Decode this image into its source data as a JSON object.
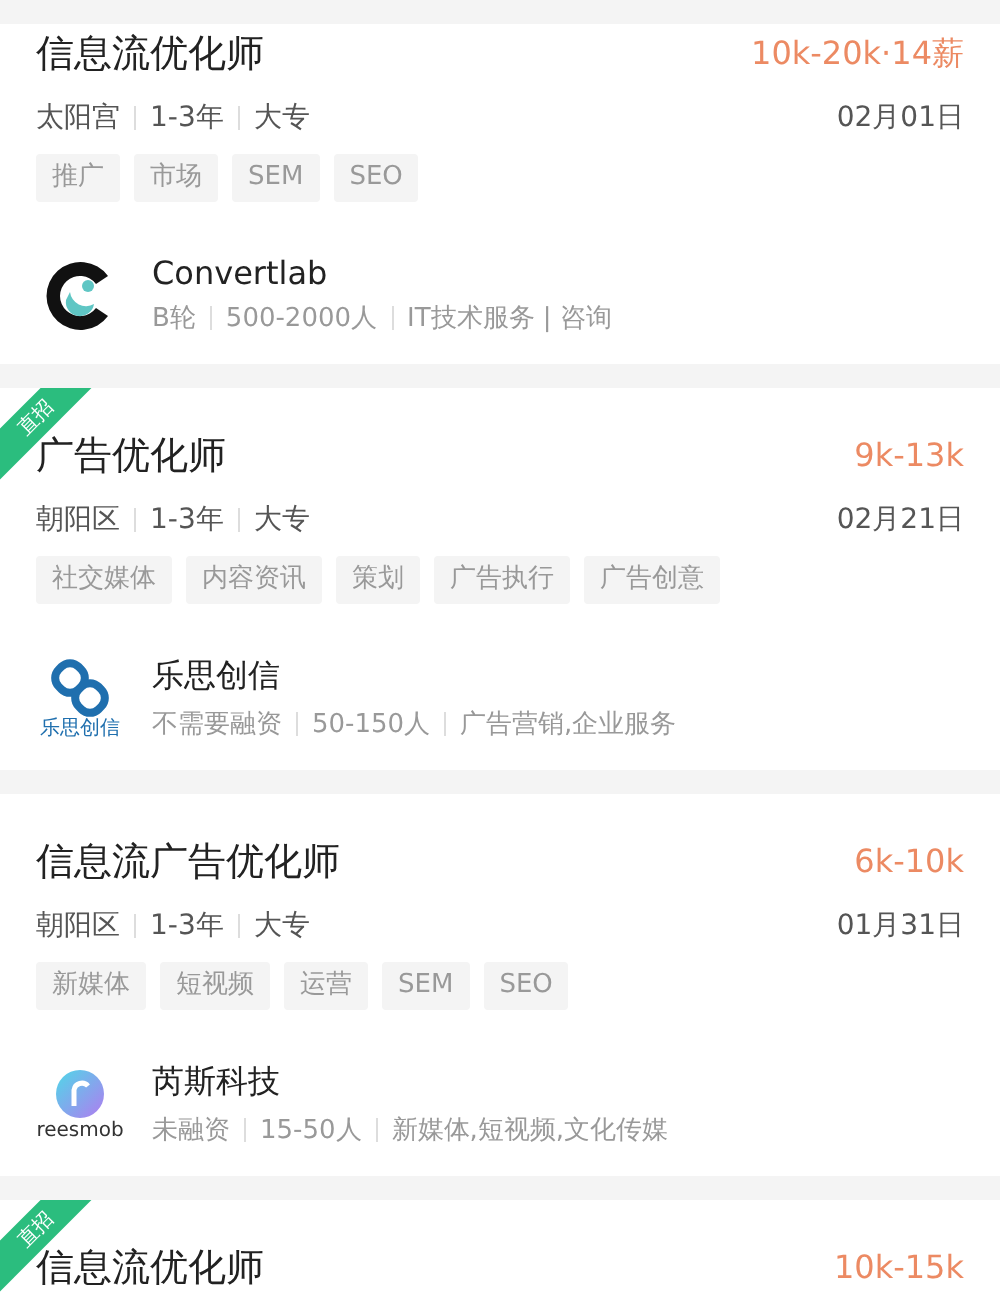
{
  "jobs": [
    {
      "title": "信息流优化师",
      "salary": "10k-20k·14薪",
      "meta": [
        "太阳宫",
        "1-3年",
        "大专"
      ],
      "date": "02月01日",
      "tags": [
        "推广",
        "市场",
        "SEM",
        "SEO"
      ],
      "company": {
        "kind": "ring",
        "name": "Convertlab",
        "meta": [
          "B轮",
          "500-2000人",
          "IT技术服务 | 咨询"
        ]
      }
    },
    {
      "title": "广告优化师",
      "salary": "9k-13k",
      "badge": "直招",
      "meta": [
        "朝阳区",
        "1-3年",
        "大专"
      ],
      "date": "02月21日",
      "tags": [
        "社交媒体",
        "内容资讯",
        "策划",
        "广告执行",
        "广告创意"
      ],
      "company": {
        "kind": "knot",
        "logo_text": "乐思创信",
        "name": "乐思创信",
        "meta": [
          "不需要融资",
          "50-150人",
          "广告营销,企业服务"
        ]
      }
    },
    {
      "title": "信息流广告优化师",
      "salary": "6k-10k",
      "meta": [
        "朝阳区",
        "1-3年",
        "大专"
      ],
      "date": "01月31日",
      "tags": [
        "新媒体",
        "短视频",
        "运营",
        "SEM",
        "SEO"
      ],
      "company": {
        "kind": "bubble",
        "logo_text": "reesmob",
        "name": "芮斯科技",
        "meta": [
          "未融资",
          "15-50人",
          "新媒体,短视频,文化传媒"
        ]
      }
    },
    {
      "title": "信息流优化师",
      "salary": "10k-15k",
      "badge": "直招"
    }
  ]
}
